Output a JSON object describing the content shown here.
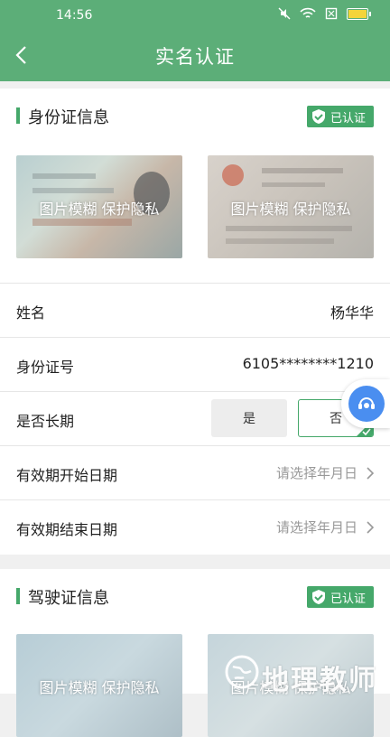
{
  "status_bar": {
    "time": "14:56"
  },
  "header": {
    "title": "实名认证"
  },
  "id_section": {
    "title": "身份证信息",
    "badge": "已认证",
    "photo_caption_front": "图片模糊 保护隐私",
    "photo_caption_back": "图片模糊 保护隐私",
    "name_label": "姓名",
    "name_value": "杨华华",
    "id_label": "身份证号",
    "id_value": "6105********1210",
    "longterm_label": "是否长期",
    "longterm_yes": "是",
    "longterm_no": "否",
    "start_label": "有效期开始日期",
    "start_placeholder": "请选择年月日",
    "end_label": "有效期结束日期",
    "end_placeholder": "请选择年月日"
  },
  "driver_section": {
    "title": "驾驶证信息",
    "badge": "已认证",
    "photo_caption_front": "图片模糊 保护隐私",
    "photo_caption_back": "图片模糊 保护隐私"
  },
  "watermark": {
    "text": "地理教师"
  },
  "colors": {
    "brand": "#5cae78",
    "accent": "#45a86a",
    "float_button": "#4a8ef0"
  }
}
